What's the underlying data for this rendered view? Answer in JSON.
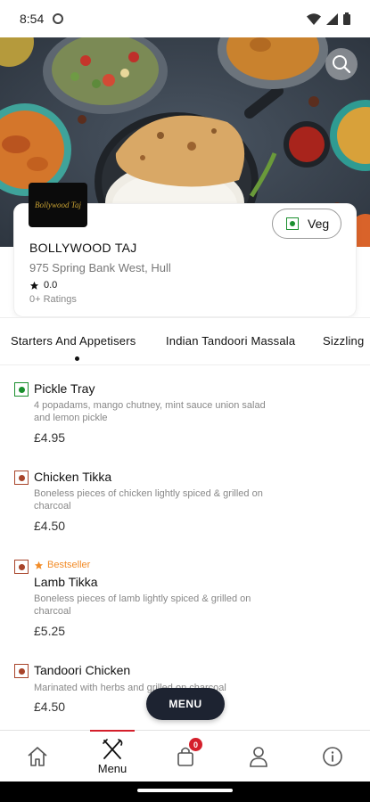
{
  "status_bar": {
    "time": "8:54"
  },
  "restaurant": {
    "logo_text": "Bollywood Taj",
    "name": "BOLLYWOOD TAJ",
    "address": "975 Spring Bank West, Hull",
    "rating": "0.0",
    "rating_count": "0+ Ratings",
    "veg_toggle_label": "Veg"
  },
  "categories": [
    {
      "label": "Starters And Appetisers"
    },
    {
      "label": "Indian Tandoori Massala"
    },
    {
      "label": "Sizzling"
    }
  ],
  "menu_items": [
    {
      "type": "veg",
      "name": "Pickle Tray",
      "description": "4 popadams, mango chutney, mint sauce union salad and lemon pickle",
      "price": "£4.95",
      "badge": ""
    },
    {
      "type": "non-veg",
      "name": "Chicken Tikka",
      "description": "Boneless pieces of chicken lightly spiced & grilled on charcoal",
      "price": "£4.50",
      "badge": ""
    },
    {
      "type": "non-veg",
      "name": "Lamb Tikka",
      "description": "Boneless pieces of lamb lightly spiced & grilled on charcoal",
      "price": "£5.25",
      "badge": "Bestseller"
    },
    {
      "type": "non-veg",
      "name": "Tandoori Chicken",
      "description": "Marinated with herbs and grilled on charcoal",
      "price": "£4.50",
      "badge": ""
    }
  ],
  "menu_button_label": "MENU",
  "bottom_nav": {
    "menu_label": "Menu",
    "cart_count": "0",
    "icons": [
      "home-icon",
      "cutlery-icon",
      "shopping-bag-icon",
      "user-icon",
      "info-icon"
    ]
  },
  "colors": {
    "veg": "#1a8f2e",
    "non_veg": "#a8442a",
    "accent": "#d41f2b",
    "bestseller": "#f28c28",
    "fab": "#1d2331"
  }
}
